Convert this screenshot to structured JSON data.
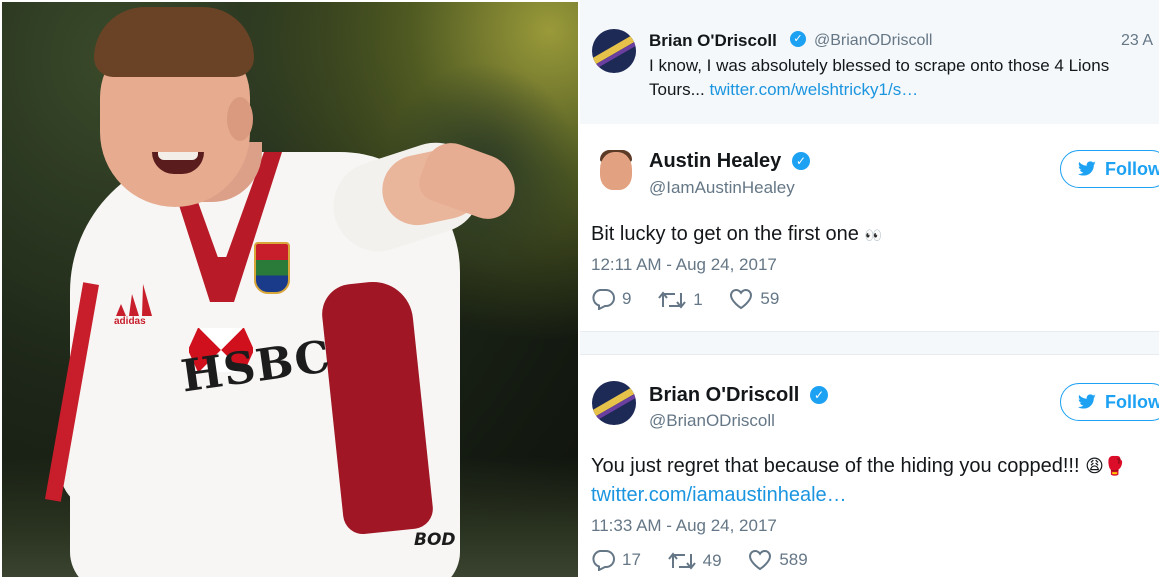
{
  "tweets": [
    {
      "name": "Brian O'Driscoll",
      "handle": "@BrianODriscoll",
      "date": "23 A",
      "text_line1": "I know, I was absolutely blessed to scrape onto those 4 Lions",
      "text_line2_prefix": "Tours... ",
      "text_link": "twitter.com/welshtricky1/s…"
    },
    {
      "name": "Austin Healey",
      "handle": "@IamAustinHealey",
      "follow_label": "Follow",
      "text": "Bit lucky to get on the first one",
      "emoji": "👀",
      "timestamp": "12:11 AM - Aug 24, 2017",
      "replies": "9",
      "retweets": "1",
      "likes": "59"
    },
    {
      "name": "Brian O'Driscoll",
      "handle": "@BrianODriscoll",
      "follow_label": "Follow",
      "text": "You just regret that because of the hiding you copped!!!",
      "emoji": "😩🥊",
      "link": "twitter.com/iamaustinheale…",
      "timestamp": "11:33 AM - Aug 24, 2017",
      "replies": "17",
      "retweets": "49",
      "likes": "589"
    }
  ],
  "photo": {
    "jersey_sponsor": "HSBC",
    "kit_brand": "BOD"
  },
  "colors": {
    "twitter_blue": "#1da1f2",
    "link_blue": "#1b95e0",
    "text_dark": "#14171a",
    "text_gray": "#657786",
    "lions_red": "#b81a28"
  },
  "icons": [
    "reply-icon",
    "retweet-icon",
    "heart-icon",
    "verified-icon",
    "twitter-bird-icon"
  ]
}
